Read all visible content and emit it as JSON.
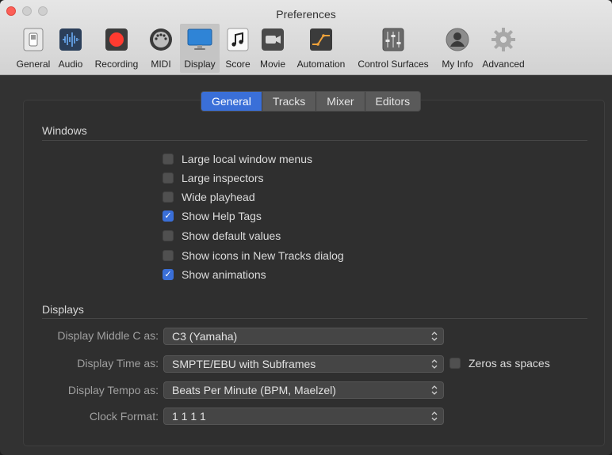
{
  "window": {
    "title": "Preferences"
  },
  "toolbar": {
    "items": [
      {
        "label": "General",
        "icon": "switch-icon"
      },
      {
        "label": "Audio",
        "icon": "waveform-icon"
      },
      {
        "label": "Recording",
        "icon": "record-icon"
      },
      {
        "label": "MIDI",
        "icon": "midi-port-icon"
      },
      {
        "label": "Display",
        "icon": "monitor-icon"
      },
      {
        "label": "Score",
        "icon": "music-note-icon"
      },
      {
        "label": "Movie",
        "icon": "camera-icon"
      },
      {
        "label": "Automation",
        "icon": "automation-curve-icon"
      },
      {
        "label": "Control Surfaces",
        "icon": "faders-icon"
      },
      {
        "label": "My Info",
        "icon": "user-icon"
      },
      {
        "label": "Advanced",
        "icon": "gear-icon"
      }
    ],
    "selected": "Display"
  },
  "tabs": [
    {
      "label": "General",
      "active": true
    },
    {
      "label": "Tracks",
      "active": false
    },
    {
      "label": "Mixer",
      "active": false
    },
    {
      "label": "Editors",
      "active": false
    }
  ],
  "windows_section": {
    "title": "Windows",
    "options": [
      {
        "label": "Large local window menus",
        "checked": false
      },
      {
        "label": "Large inspectors",
        "checked": false
      },
      {
        "label": "Wide playhead",
        "checked": false
      },
      {
        "label": "Show Help Tags",
        "checked": true
      },
      {
        "label": "Show default values",
        "checked": false
      },
      {
        "label": "Show icons in New Tracks dialog",
        "checked": false
      },
      {
        "label": "Show animations",
        "checked": true
      }
    ]
  },
  "displays_section": {
    "title": "Displays",
    "middle_c": {
      "label": "Display Middle C as:",
      "value": "C3 (Yamaha)"
    },
    "time": {
      "label": "Display Time as:",
      "value": "SMPTE/EBU with Subframes"
    },
    "zeros_as_spaces": {
      "label": "Zeros as spaces",
      "checked": false
    },
    "tempo": {
      "label": "Display Tempo as:",
      "value": "Beats Per Minute (BPM, Maelzel)"
    },
    "clock": {
      "label": "Clock Format:",
      "value": "1 1 1 1"
    }
  },
  "colors": {
    "accent": "#3a6fd8",
    "record": "#ff3b30"
  }
}
